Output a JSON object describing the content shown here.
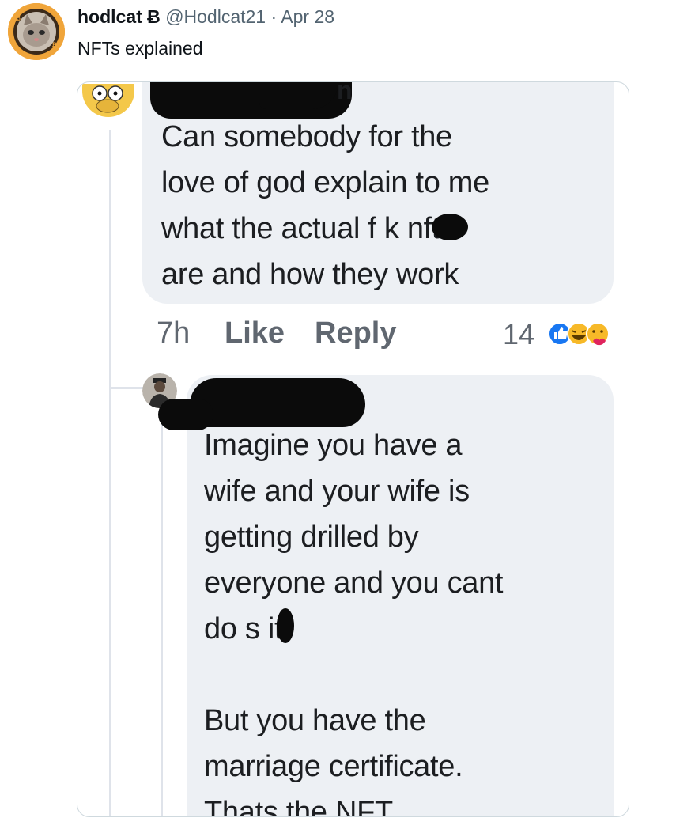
{
  "tweet": {
    "display_name": "hodlcat",
    "verified_glyph": "Ƀ",
    "handle": "@Hodlcat21",
    "separator": "·",
    "date": "Apr 28",
    "text": "NFTs explained",
    "avatar_icon": "cat-avatar-icon"
  },
  "screenshot": {
    "comment1": {
      "name_visible": "n",
      "text": "Can somebody for the\nlove of god explain to me\nwhat the actual f   k nfts\nare and how they work",
      "time": "7h",
      "like": "Like",
      "reply": "Reply",
      "reaction_count": "14",
      "reaction_icons": [
        "like-reaction-icon",
        "haha-reaction-icon",
        "care-reaction-icon"
      ]
    },
    "comment2": {
      "text": "Imagine you have a\nwife and your wife is\ngetting drilled by\neveryone and you cant\ndo s  it.\n\nBut you have the\nmarriage certificate.\nThats the NFT"
    }
  },
  "colors": {
    "avatar_ring": "#f0a53a",
    "bubble": "#edf0f4",
    "like_blue": "#1877f2",
    "haha_yellow": "#f7b928"
  }
}
